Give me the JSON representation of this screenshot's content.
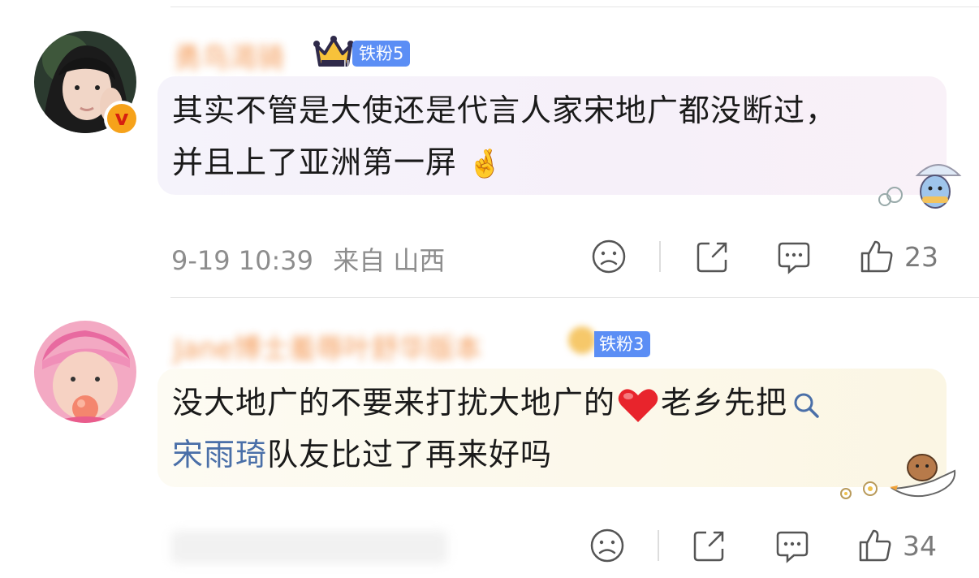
{
  "comments": [
    {
      "username": "勇鸟渴骑",
      "fan_badge": "铁粉5",
      "text_line1": "其实不管是大使还是代言人家宋地广都没断过，",
      "text_line2": "并且上了亚洲第一屏",
      "emoji": "🤞",
      "timestamp": "9-19 10:39",
      "source": "来自 山西",
      "like_count": "23",
      "verified_mark": "v"
    },
    {
      "username": "Jane博士羞辱叶舒华版本",
      "fan_badge": "铁粉3",
      "text_part1": "没大地广的不要来打扰大地广的",
      "text_part2": "老乡先把",
      "link_text": "宋雨琦",
      "text_part3": "队友比过了再来好吗",
      "like_count": "34"
    }
  ],
  "colors": {
    "username": "#f28a3c",
    "fan_badge_bg": "#5b8ef5",
    "link": "#4a6fa8",
    "meta": "#8d8d8d",
    "heart": "#e8242c"
  }
}
